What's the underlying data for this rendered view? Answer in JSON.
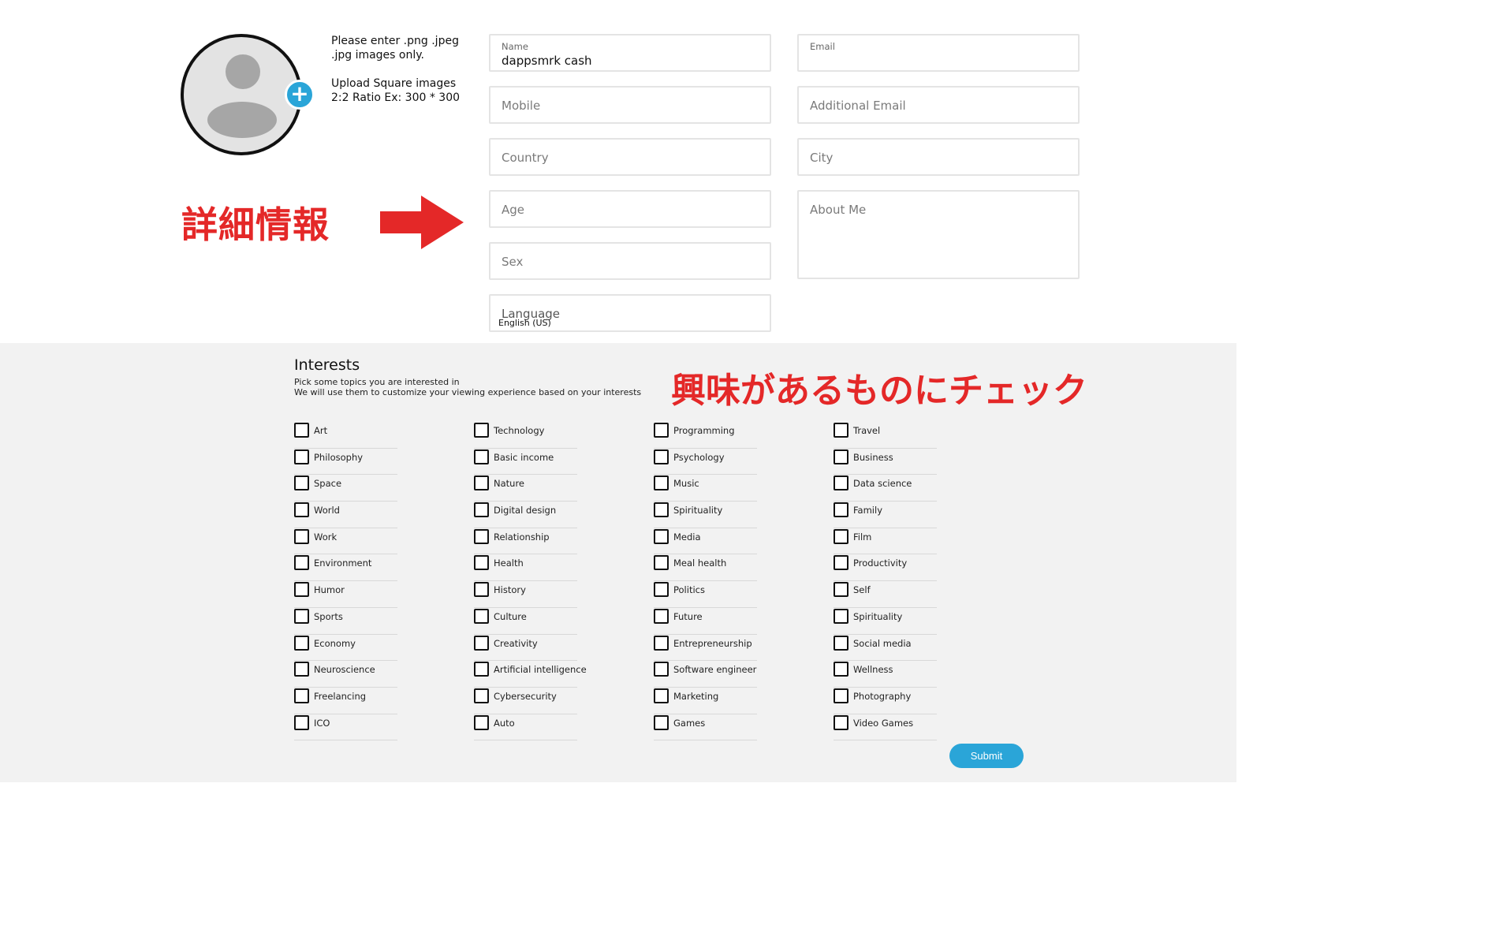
{
  "upload": {
    "note_line1": "Please enter .png .jpeg .jpg images only.",
    "note_line2": "Upload Square images 2:2 Ratio Ex: 300 * 300"
  },
  "annotations": {
    "details_jp": "詳細情報",
    "interests_jp": "興味があるものにチェック",
    "accent_color": "#e42828"
  },
  "form": {
    "name_label": "Name",
    "name_value": "dappsmrk cash",
    "email_label": "Email",
    "mobile_placeholder": "Mobile",
    "additional_email_placeholder": "Additional Email",
    "country_placeholder": "Country",
    "city_placeholder": "City",
    "age_placeholder": "Age",
    "about_placeholder": "About Me",
    "sex_placeholder": "Sex",
    "language_label": "Language",
    "language_value": "English (US)"
  },
  "interests": {
    "title": "Interests",
    "desc_line1": "Pick some topics you are interested in",
    "desc_line2": "We will use them to customize your viewing experience based on your interests",
    "col1": [
      "Art",
      "Philosophy",
      "Space",
      "World",
      "Work",
      "Environment",
      "Humor",
      "Sports",
      "Economy",
      "Neuroscience",
      "Freelancing",
      "ICO"
    ],
    "col2": [
      "Technology",
      "Basic income",
      "Nature",
      "Digital design",
      "Relationship",
      "Health",
      "History",
      "Culture",
      "Creativity",
      "Artificial intelligence",
      "Cybersecurity",
      "Auto"
    ],
    "col3": [
      "Programming",
      "Psychology",
      "Music",
      "Spirituality",
      "Media",
      "Meal health",
      "Politics",
      "Future",
      "Entrepreneurship",
      "Software engineer",
      "Marketing",
      "Games"
    ],
    "col4": [
      "Travel",
      "Business",
      "Data science",
      "Family",
      "Film",
      "Productivity",
      "Self",
      "Spirituality",
      "Social media",
      "Wellness",
      "Photography",
      "Video Games"
    ]
  },
  "submit_label": "Submit",
  "colors": {
    "primary": "#2aa5d8",
    "panel_bg": "#f2f2f2"
  },
  "icons": {
    "add_photo": "plus-icon",
    "avatar": "user-placeholder-icon",
    "arrow": "right-arrow-icon"
  }
}
